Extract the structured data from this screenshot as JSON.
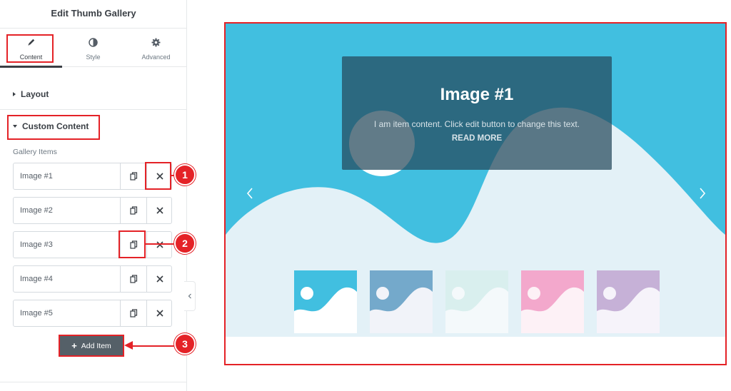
{
  "panel": {
    "title": "Edit Thumb Gallery",
    "tabs": [
      {
        "label": "Content",
        "icon": "pencil-icon",
        "active": true
      },
      {
        "label": "Style",
        "icon": "contrast-icon",
        "active": false
      },
      {
        "label": "Advanced",
        "icon": "gear-icon",
        "active": false
      }
    ],
    "sections": {
      "layout": {
        "label": "Layout",
        "expanded": false
      },
      "custom_content": {
        "label": "Custom Content",
        "expanded": true
      }
    },
    "gallery_label": "Gallery Items",
    "items": [
      {
        "title": "Image #1"
      },
      {
        "title": "Image #2"
      },
      {
        "title": "Image #3"
      },
      {
        "title": "Image #4"
      },
      {
        "title": "Image #5"
      }
    ],
    "add_item_label": "Add Item"
  },
  "markers": [
    "1",
    "2",
    "3"
  ],
  "preview": {
    "slide_title": "Image #1",
    "slide_text": "I am item content. Click edit button to change this text.",
    "slide_link": "READ MORE",
    "thumb_colors": [
      "#41bfe0",
      "#74a9cb",
      "#d9efee",
      "#f3a8cc",
      "#c6b1d7"
    ]
  },
  "colors": {
    "accent_red": "#e42227",
    "sky": "#41bfe0",
    "hill": "#e3f1f7",
    "button_dark": "#556068"
  }
}
